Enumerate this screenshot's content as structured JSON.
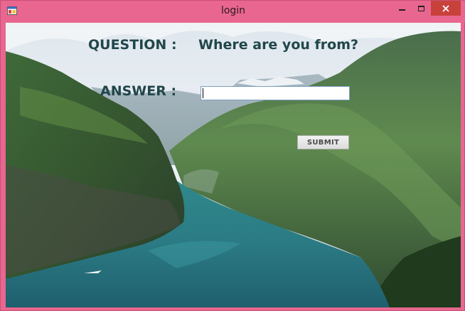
{
  "window": {
    "title": "login",
    "frame_color": "#e8668f",
    "close_color": "#c8423b",
    "icons": [
      "app-icon",
      "minimize-icon",
      "maximize-icon",
      "close-icon"
    ]
  },
  "form": {
    "question_label": "QUESTION :",
    "question_text": "Where are you from?",
    "answer_label": "ANSWER :",
    "answer_value": "",
    "submit_label": "SUBMIT",
    "text_color": "#21464a"
  },
  "background": {
    "subject": "fjord landscape photo"
  }
}
